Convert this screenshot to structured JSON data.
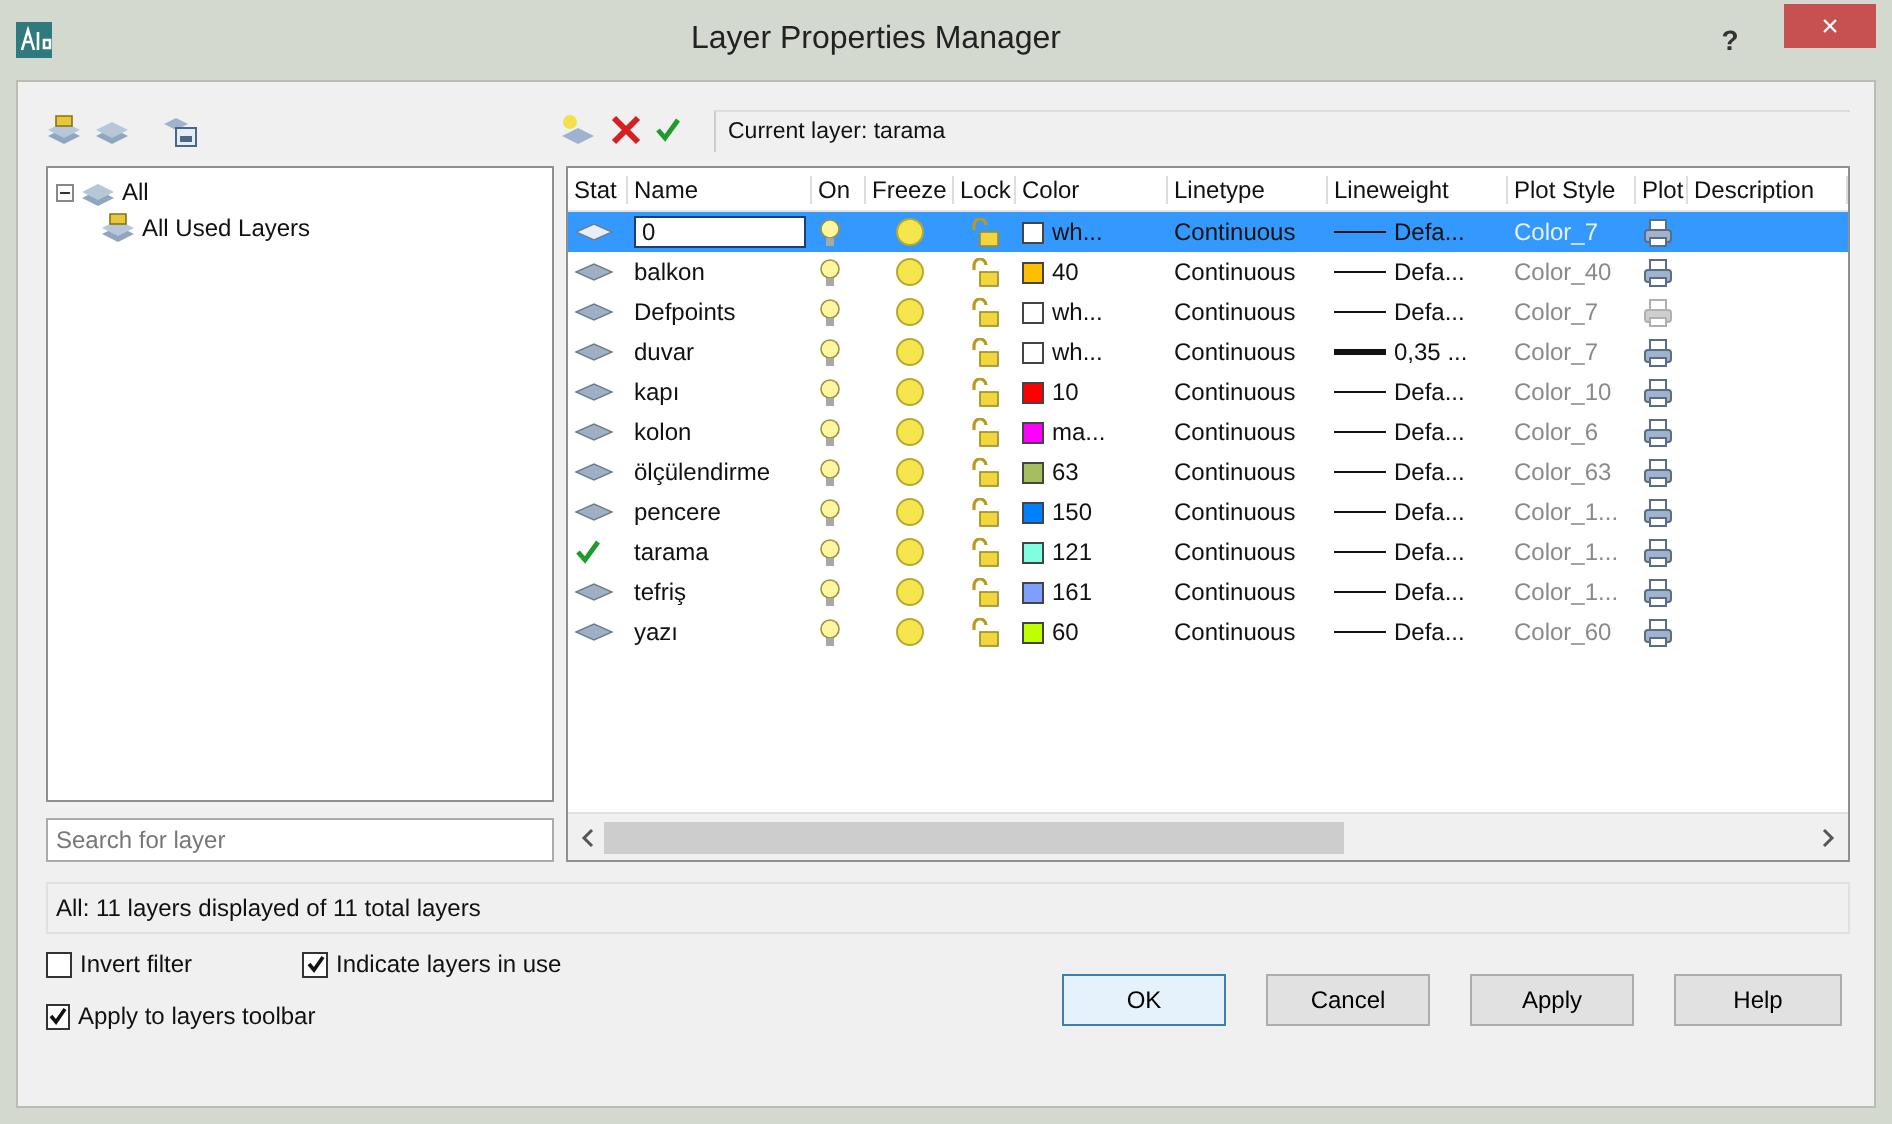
{
  "window": {
    "title": "Layer Properties Manager",
    "help": "?",
    "close": "×"
  },
  "toolbar": {
    "current_layer": "Current layer: tarama"
  },
  "tree": [
    {
      "label": "All",
      "expanded": true,
      "children": [
        {
          "label": "All Used Layers"
        }
      ]
    }
  ],
  "search": {
    "placeholder": "Search for layer"
  },
  "table": {
    "columns": [
      "Stat",
      "Name",
      "On",
      "Freeze",
      "Lock",
      "Color",
      "Linetype",
      "Lineweight",
      "Plot Style",
      "Plot",
      "Description"
    ],
    "rows": [
      {
        "current": false,
        "selected": true,
        "name": "0",
        "on": true,
        "frozen": false,
        "locked": false,
        "color": "#ffffff",
        "color_label": "wh...",
        "linetype": "Continuous",
        "heavy_line": false,
        "lineweight_label": "Defa...",
        "plot_style": "Color_7",
        "plot": true
      },
      {
        "current": false,
        "selected": false,
        "name": "balkon",
        "on": true,
        "frozen": false,
        "locked": false,
        "color": "#ffbf00",
        "color_label": "40",
        "linetype": "Continuous",
        "heavy_line": false,
        "lineweight_label": "Defa...",
        "plot_style": "Color_40",
        "plot": true
      },
      {
        "current": false,
        "selected": false,
        "name": "Defpoints",
        "on": true,
        "frozen": false,
        "locked": false,
        "color": "#ffffff",
        "color_label": "wh...",
        "linetype": "Continuous",
        "heavy_line": false,
        "lineweight_label": "Defa...",
        "plot_style": "Color_7",
        "plot": false
      },
      {
        "current": false,
        "selected": false,
        "name": "duvar",
        "on": true,
        "frozen": false,
        "locked": false,
        "color": "#ffffff",
        "color_label": "wh...",
        "linetype": "Continuous",
        "heavy_line": true,
        "lineweight_label": "0,35 ...",
        "plot_style": "Color_7",
        "plot": true
      },
      {
        "current": false,
        "selected": false,
        "name": "kapı",
        "on": true,
        "frozen": false,
        "locked": false,
        "color": "#ff0000",
        "color_label": "10",
        "linetype": "Continuous",
        "heavy_line": false,
        "lineweight_label": "Defa...",
        "plot_style": "Color_10",
        "plot": true
      },
      {
        "current": false,
        "selected": false,
        "name": "kolon",
        "on": true,
        "frozen": false,
        "locked": false,
        "color": "#ff00ff",
        "color_label": "ma...",
        "linetype": "Continuous",
        "heavy_line": false,
        "lineweight_label": "Defa...",
        "plot_style": "Color_6",
        "plot": true
      },
      {
        "current": false,
        "selected": false,
        "name": "ölçülendirme",
        "on": true,
        "frozen": false,
        "locked": false,
        "color": "#a5bf5f",
        "color_label": "63",
        "linetype": "Continuous",
        "heavy_line": false,
        "lineweight_label": "Defa...",
        "plot_style": "Color_63",
        "plot": true
      },
      {
        "current": false,
        "selected": false,
        "name": "pencere",
        "on": true,
        "frozen": false,
        "locked": false,
        "color": "#007fff",
        "color_label": "150",
        "linetype": "Continuous",
        "heavy_line": false,
        "lineweight_label": "Defa...",
        "plot_style": "Color_1...",
        "plot": true
      },
      {
        "current": true,
        "selected": false,
        "name": "tarama",
        "on": true,
        "frozen": false,
        "locked": false,
        "color": "#7fffdf",
        "color_label": "121",
        "linetype": "Continuous",
        "heavy_line": false,
        "lineweight_label": "Defa...",
        "plot_style": "Color_1...",
        "plot": true
      },
      {
        "current": false,
        "selected": false,
        "name": "tefriş",
        "on": true,
        "frozen": false,
        "locked": false,
        "color": "#7f9fff",
        "color_label": "161",
        "linetype": "Continuous",
        "heavy_line": false,
        "lineweight_label": "Defa...",
        "plot_style": "Color_1...",
        "plot": true
      },
      {
        "current": false,
        "selected": false,
        "name": "yazı",
        "on": true,
        "frozen": false,
        "locked": false,
        "color": "#bfff00",
        "color_label": "60",
        "linetype": "Continuous",
        "heavy_line": false,
        "lineweight_label": "Defa...",
        "plot_style": "Color_60",
        "plot": true
      }
    ]
  },
  "status_bar": "All: 11 layers displayed of 11 total layers",
  "options": [
    {
      "label": "Invert filter",
      "checked": false
    },
    {
      "label": "Indicate layers in use",
      "checked": true
    },
    {
      "label": "Apply to layers toolbar",
      "checked": true
    }
  ],
  "buttons": [
    {
      "label": "OK",
      "default": true
    },
    {
      "label": "Cancel",
      "default": false
    },
    {
      "label": "Apply",
      "default": false
    },
    {
      "label": "Help",
      "default": false
    }
  ]
}
